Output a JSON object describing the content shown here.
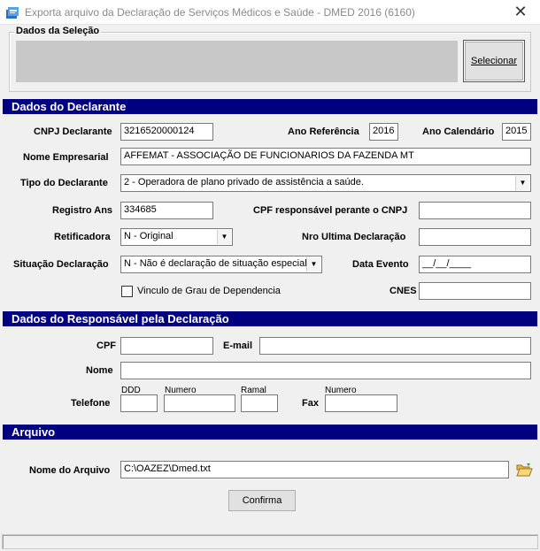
{
  "window": {
    "title": "Exporta arquivo da Declaração de Serviços Médicos e Saúde - DMED 2016 (6160)",
    "close_glyph": "✕"
  },
  "selection": {
    "group_title": "Dados da Seleção",
    "select_button": "Selecionar"
  },
  "declarante": {
    "section_title": "Dados do Declarante",
    "cnpj_label": "CNPJ Declarante",
    "cnpj_value": "3216520000124",
    "ano_ref_label": "Ano Referência",
    "ano_ref_value": "2016",
    "ano_cal_label": "Ano Calendário",
    "ano_cal_value": "2015",
    "nome_label": "Nome Empresarial",
    "nome_value": "AFFEMAT - ASSOCIAÇÃO DE FUNCIONARIOS DA FAZENDA MT",
    "tipo_label": "Tipo do Declarante",
    "tipo_value": "2 - Operadora de plano privado de assistência a saúde.",
    "registro_label": "Registro Ans",
    "registro_value": "334685",
    "cpf_resp_label": "CPF responsável perante o CNPJ",
    "cpf_resp_value": "",
    "retificadora_label": "Retificadora",
    "retificadora_value": "N - Original",
    "nro_ultima_label": "Nro Ultima Declaração",
    "nro_ultima_value": "",
    "situacao_label": "Situação Declaração",
    "situacao_value": "N - Não é declaração de situação especial",
    "data_evento_label": "Data Evento",
    "data_evento_value": "__/__/____",
    "vinculo_label": "Vinculo de Grau de Dependencia",
    "vinculo_checked": false,
    "cnes_label": "CNES",
    "cnes_value": ""
  },
  "responsavel": {
    "section_title": "Dados do Responsável pela Declaração",
    "cpf_label": "CPF",
    "cpf_value": "",
    "email_label": "E-mail",
    "email_value": "",
    "nome_label": "Nome",
    "nome_value": "",
    "telefone_label": "Telefone",
    "ddd_label": "DDD",
    "ddd_value": "",
    "numero_label": "Numero",
    "numero_value": "",
    "ramal_label": "Ramal",
    "ramal_value": "",
    "fax_label": "Fax",
    "fax_numero_label": "Numero",
    "fax_value": ""
  },
  "arquivo": {
    "section_title": "Arquivo",
    "nome_label": "Nome do Arquivo",
    "nome_value": "C:\\OAZEZ\\Dmed.txt",
    "confirm_button": "Confirma"
  },
  "colors": {
    "section_bar": "#000080",
    "window_bg": "#f0f0f0"
  }
}
